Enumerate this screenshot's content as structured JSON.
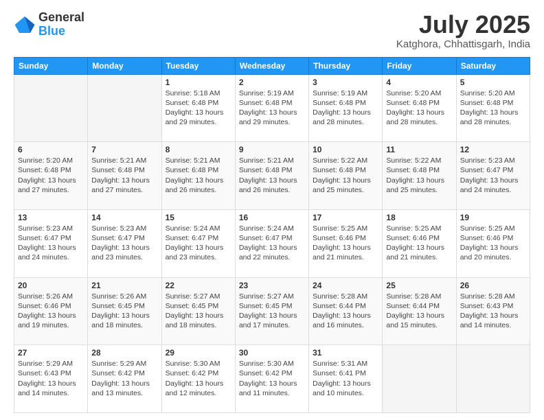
{
  "logo": {
    "general": "General",
    "blue": "Blue"
  },
  "title": "July 2025",
  "subtitle": "Katghora, Chhattisgarh, India",
  "weekdays": [
    "Sunday",
    "Monday",
    "Tuesday",
    "Wednesday",
    "Thursday",
    "Friday",
    "Saturday"
  ],
  "weeks": [
    [
      {
        "day": "",
        "info": ""
      },
      {
        "day": "",
        "info": ""
      },
      {
        "day": "1",
        "info": "Sunrise: 5:18 AM\nSunset: 6:48 PM\nDaylight: 13 hours and 29 minutes."
      },
      {
        "day": "2",
        "info": "Sunrise: 5:19 AM\nSunset: 6:48 PM\nDaylight: 13 hours and 29 minutes."
      },
      {
        "day": "3",
        "info": "Sunrise: 5:19 AM\nSunset: 6:48 PM\nDaylight: 13 hours and 28 minutes."
      },
      {
        "day": "4",
        "info": "Sunrise: 5:20 AM\nSunset: 6:48 PM\nDaylight: 13 hours and 28 minutes."
      },
      {
        "day": "5",
        "info": "Sunrise: 5:20 AM\nSunset: 6:48 PM\nDaylight: 13 hours and 28 minutes."
      }
    ],
    [
      {
        "day": "6",
        "info": "Sunrise: 5:20 AM\nSunset: 6:48 PM\nDaylight: 13 hours and 27 minutes."
      },
      {
        "day": "7",
        "info": "Sunrise: 5:21 AM\nSunset: 6:48 PM\nDaylight: 13 hours and 27 minutes."
      },
      {
        "day": "8",
        "info": "Sunrise: 5:21 AM\nSunset: 6:48 PM\nDaylight: 13 hours and 26 minutes."
      },
      {
        "day": "9",
        "info": "Sunrise: 5:21 AM\nSunset: 6:48 PM\nDaylight: 13 hours and 26 minutes."
      },
      {
        "day": "10",
        "info": "Sunrise: 5:22 AM\nSunset: 6:48 PM\nDaylight: 13 hours and 25 minutes."
      },
      {
        "day": "11",
        "info": "Sunrise: 5:22 AM\nSunset: 6:48 PM\nDaylight: 13 hours and 25 minutes."
      },
      {
        "day": "12",
        "info": "Sunrise: 5:23 AM\nSunset: 6:47 PM\nDaylight: 13 hours and 24 minutes."
      }
    ],
    [
      {
        "day": "13",
        "info": "Sunrise: 5:23 AM\nSunset: 6:47 PM\nDaylight: 13 hours and 24 minutes."
      },
      {
        "day": "14",
        "info": "Sunrise: 5:23 AM\nSunset: 6:47 PM\nDaylight: 13 hours and 23 minutes."
      },
      {
        "day": "15",
        "info": "Sunrise: 5:24 AM\nSunset: 6:47 PM\nDaylight: 13 hours and 23 minutes."
      },
      {
        "day": "16",
        "info": "Sunrise: 5:24 AM\nSunset: 6:47 PM\nDaylight: 13 hours and 22 minutes."
      },
      {
        "day": "17",
        "info": "Sunrise: 5:25 AM\nSunset: 6:46 PM\nDaylight: 13 hours and 21 minutes."
      },
      {
        "day": "18",
        "info": "Sunrise: 5:25 AM\nSunset: 6:46 PM\nDaylight: 13 hours and 21 minutes."
      },
      {
        "day": "19",
        "info": "Sunrise: 5:25 AM\nSunset: 6:46 PM\nDaylight: 13 hours and 20 minutes."
      }
    ],
    [
      {
        "day": "20",
        "info": "Sunrise: 5:26 AM\nSunset: 6:46 PM\nDaylight: 13 hours and 19 minutes."
      },
      {
        "day": "21",
        "info": "Sunrise: 5:26 AM\nSunset: 6:45 PM\nDaylight: 13 hours and 18 minutes."
      },
      {
        "day": "22",
        "info": "Sunrise: 5:27 AM\nSunset: 6:45 PM\nDaylight: 13 hours and 18 minutes."
      },
      {
        "day": "23",
        "info": "Sunrise: 5:27 AM\nSunset: 6:45 PM\nDaylight: 13 hours and 17 minutes."
      },
      {
        "day": "24",
        "info": "Sunrise: 5:28 AM\nSunset: 6:44 PM\nDaylight: 13 hours and 16 minutes."
      },
      {
        "day": "25",
        "info": "Sunrise: 5:28 AM\nSunset: 6:44 PM\nDaylight: 13 hours and 15 minutes."
      },
      {
        "day": "26",
        "info": "Sunrise: 5:28 AM\nSunset: 6:43 PM\nDaylight: 13 hours and 14 minutes."
      }
    ],
    [
      {
        "day": "27",
        "info": "Sunrise: 5:29 AM\nSunset: 6:43 PM\nDaylight: 13 hours and 14 minutes."
      },
      {
        "day": "28",
        "info": "Sunrise: 5:29 AM\nSunset: 6:42 PM\nDaylight: 13 hours and 13 minutes."
      },
      {
        "day": "29",
        "info": "Sunrise: 5:30 AM\nSunset: 6:42 PM\nDaylight: 13 hours and 12 minutes."
      },
      {
        "day": "30",
        "info": "Sunrise: 5:30 AM\nSunset: 6:42 PM\nDaylight: 13 hours and 11 minutes."
      },
      {
        "day": "31",
        "info": "Sunrise: 5:31 AM\nSunset: 6:41 PM\nDaylight: 13 hours and 10 minutes."
      },
      {
        "day": "",
        "info": ""
      },
      {
        "day": "",
        "info": ""
      }
    ]
  ]
}
